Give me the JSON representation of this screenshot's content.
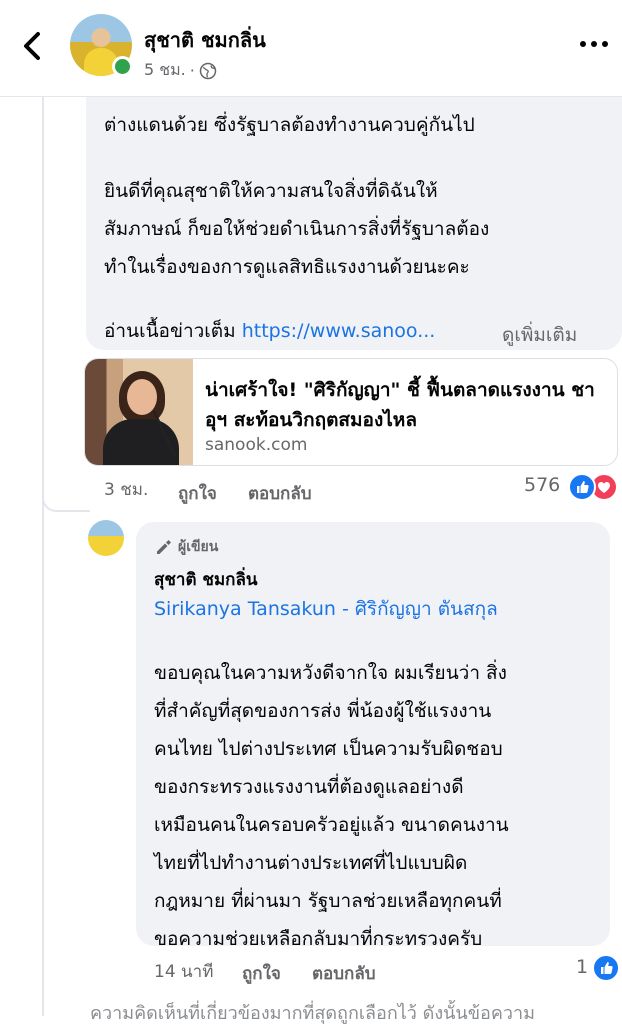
{
  "header": {
    "name": "สุชาติ ชมกลิ่น",
    "time": "5 ชม.",
    "separator": "·"
  },
  "comment1": {
    "partial_top_line": "",
    "lines": [
      "ต่างแดนด้วย ซึ่งรัฐบาลต้องทำงานควบคู่กันไป",
      "ยินดีที่คุณสุชาติให้ความสนใจสิ่งที่ดิฉันให้",
      "สัมภาษณ์ ก็ขอให้ช่วยดำเนินการสิ่งที่รัฐบาลต้อง",
      "ทำในเรื่องของการดูแลสิทธิแรงงานด้วยนะคะ"
    ],
    "read_more_prefix": "อ่านเนื้อข่าวเต็ม",
    "read_more_link": "https://www.sanoo...",
    "see_more": "ดูเพิ่มเติม",
    "preview": {
      "title": "น่าเศร้าใจ! \"ศิริกัญญา\" ชี้ ฟื้นตลาดแรงงาน ชาอุฯ สะท้อนวิกฤตสมองไหล",
      "domain": "sanook.com"
    },
    "time": "3 ชม.",
    "like_label": "ถูกใจ",
    "reply_label": "ตอบกลับ",
    "reaction_count": "576",
    "reactions": [
      "like-icon",
      "love-icon"
    ]
  },
  "reply": {
    "badge": "ผู้เขียน",
    "name": "สุชาติ ชมกลิ่น",
    "tag": "Sirikanya Tansakun - ศิริกัญญา ตันสกุล",
    "lines": [
      "ขอบคุณในความหวังดีจากใจ ผมเรียนว่า สิ่ง",
      "ที่สำคัญที่สุดของการส่ง พี่น้องผู้ใช้แรงงาน",
      "คนไทย ไปต่างประเทศ เป็นความรับผิดชอบ",
      "ของกระทรวงแรงงานที่ต้องดูแลอย่างดี",
      "เหมือนคนในครอบครัวอยู่แล้ว ขนาดคนงาน",
      "ไทยที่ไปทำงานต่างประเทศที่ไปแบบผิด",
      "กฎหมาย ที่ผ่านมา รัฐบาลช่วยเหลือทุกคนที่",
      "ขอความช่วยเหลือกลับมาที่กระทรวงครับ"
    ],
    "time": "14 นาที",
    "like_label": "ถูกใจ",
    "reply_label": "ตอบกลับ",
    "reaction_count": "1"
  },
  "footer_note": "ความคิดเห็นที่เกี่ยวข้องมากที่สุดถูกเลือกไว้ ดังนั้นข้อความ",
  "colors": {
    "link": "#1b74e4",
    "bubble": "#f0f2f5",
    "online": "#31a24c",
    "like": "#1877f2",
    "love": "#f33e58"
  }
}
